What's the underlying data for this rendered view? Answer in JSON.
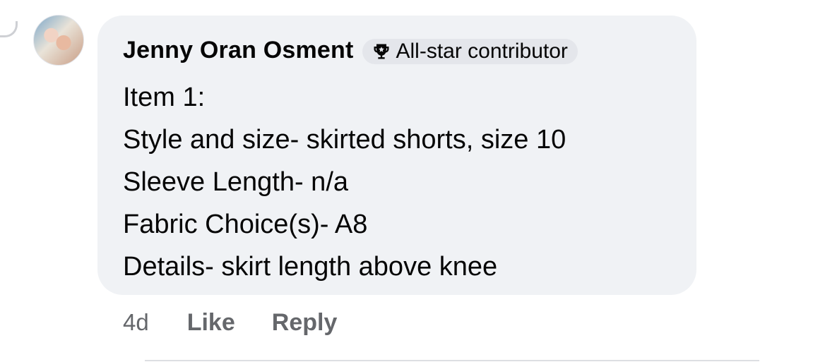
{
  "comment": {
    "author": "Jenny Oran Osment",
    "badge": {
      "icon": "trophy-icon",
      "label": "All-star contributor"
    },
    "lines": [
      "Item 1:",
      "Style and size- skirted shorts, size 10",
      "Sleeve Length- n/a",
      "Fabric Choice(s)- A8",
      "Details- skirt length above knee"
    ]
  },
  "actions": {
    "time": "4d",
    "like_label": "Like",
    "reply_label": "Reply"
  },
  "colors": {
    "bubble_bg": "#f0f2f5",
    "badge_bg": "#e4e6eb",
    "primary_text": "#050505",
    "secondary_text": "#65676b"
  }
}
